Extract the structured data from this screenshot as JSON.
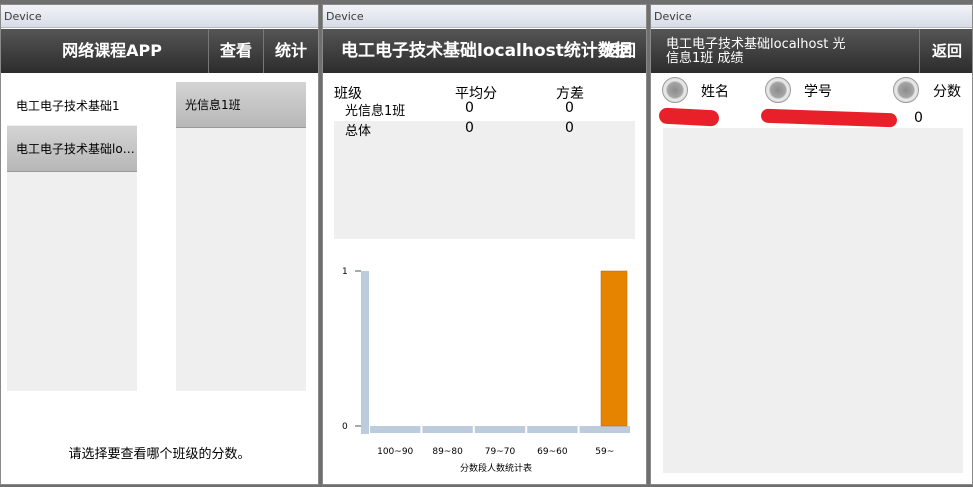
{
  "device_label": "Device",
  "screen1": {
    "title": "网络课程APP",
    "view_button": "查看",
    "stats_button": "统计",
    "courses": [
      "电工电子技术基础1",
      "电工电子技术基础localhost"
    ],
    "classes": [
      "光信息1班"
    ],
    "prompt": "请选择要查看哪个班级的分数。"
  },
  "screen2": {
    "title": "电工电子技术基础localhost统计数据",
    "back_button": "返回",
    "table": {
      "headers": [
        "班级",
        "平均分",
        "方差"
      ],
      "rows": [
        [
          "光信息1班",
          "0",
          "0"
        ],
        [
          "总体",
          "0",
          "0"
        ]
      ]
    },
    "chart_data": {
      "type": "bar",
      "categories": [
        "100~90",
        "89~80",
        "79~70",
        "69~60",
        "59~"
      ],
      "values": [
        0,
        0,
        0,
        0,
        1
      ],
      "title": "",
      "xlabel": "分数段人数统计表",
      "ylabel": "",
      "ylim": [
        0,
        1
      ],
      "yticks": [
        "0",
        "1"
      ],
      "grid": false,
      "colors": {
        "bar": "#e68400",
        "axis": "#bcccdc"
      }
    }
  },
  "screen3": {
    "title_line1": "电工电子技术基础localhost 光",
    "title_line2": "信息1班 成绩",
    "back_button": "返回",
    "radio_options": [
      "姓名",
      "学号",
      "分数"
    ],
    "row": {
      "name": "",
      "student_id": "",
      "score": "0"
    }
  }
}
